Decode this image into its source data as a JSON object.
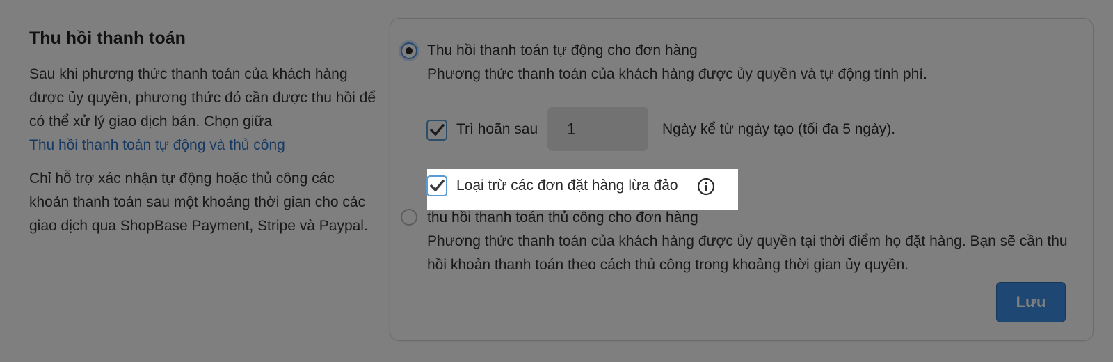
{
  "section": {
    "title": "Thu hồi thanh toán",
    "desc_line1": "Sau khi phương thức thanh toán của khách hàng được ủy quyền, phương thức đó cần được thu hồi để có thể xử lý giao dịch bán. Chọn giữa",
    "desc_link": "Thu hồi thanh toán tự động và thủ công",
    "desc_2": "Chỉ hỗ trợ xác nhận tự động hoặc thủ công các khoản thanh toán sau một khoảng thời gian cho các giao dịch qua ShopBase Payment, Stripe và Paypal."
  },
  "options": {
    "auto": {
      "title": "Thu hồi thanh toán tự động cho đơn hàng",
      "desc": "Phương thức thanh toán của khách hàng được ủy quyền và tự động tính phí.",
      "selected": true
    },
    "delay": {
      "label": "Trì hoãn sau",
      "value": "1",
      "suffix": "Ngày kể từ ngày tạo (tối đa 5 ngày).",
      "checked": true
    },
    "exclude_fraud": {
      "label": "Loại trừ các đơn đặt hàng lừa đảo",
      "checked": true,
      "icon": "info-icon"
    },
    "manual": {
      "title": "thu hồi thanh toán thủ công cho đơn hàng",
      "desc": "Phương thức thanh toán của khách hàng được ủy quyền tại thời điểm họ đặt hàng. Bạn sẽ cần thu hồi khoản thanh toán theo cách thủ công trong khoảng thời gian ủy quyền.",
      "selected": false
    }
  },
  "save_label": "Lưu",
  "colors": {
    "accent": "#3e8ee6",
    "link": "#2a73c6",
    "overlay": "rgba(0,0,0,0.5)"
  }
}
